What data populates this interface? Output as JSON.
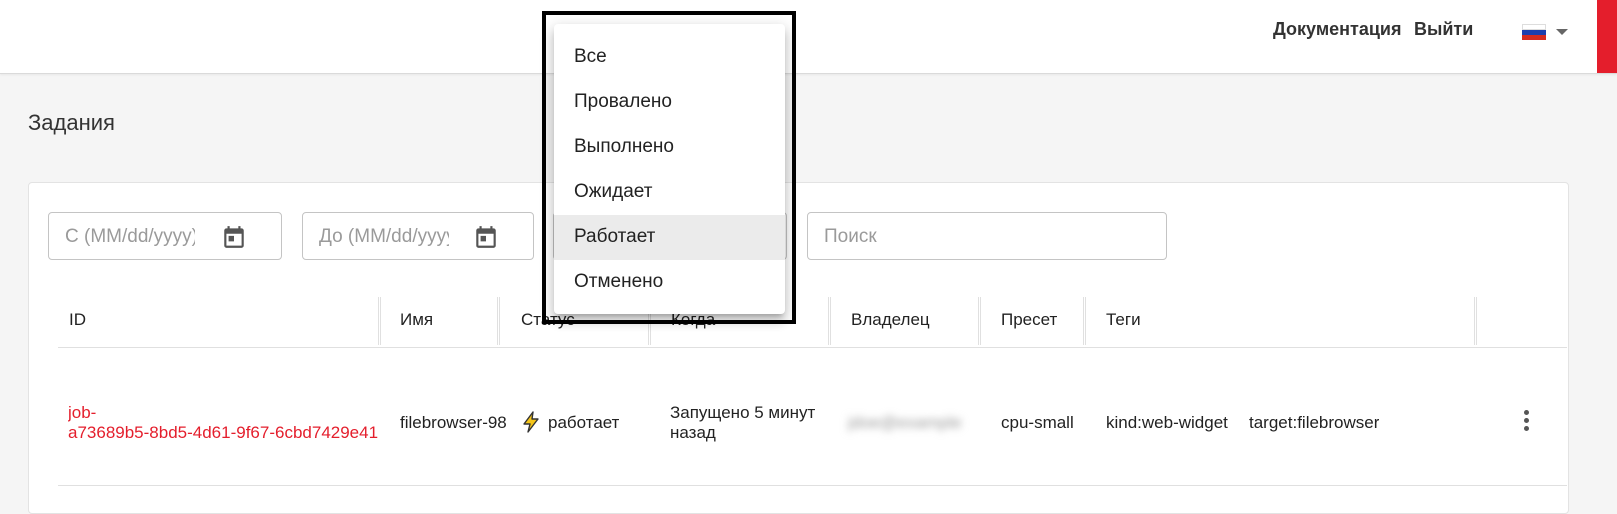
{
  "header": {
    "docs_label": "Документация",
    "logout_label": "Выйти",
    "language_flag": "ru-flag-icon",
    "accent_color": "#e41e2c"
  },
  "page": {
    "title": "Задания"
  },
  "filters": {
    "from_placeholder": "С (MM/dd/yyyy)",
    "to_placeholder": "До (MM/dd/yyyy)",
    "search_placeholder": "Поиск"
  },
  "table": {
    "headers": [
      "ID",
      "Имя",
      "Статус",
      "Когда",
      "Владелец",
      "Пресет",
      "Теги"
    ],
    "rows": [
      {
        "id_line1": "job-",
        "id_line2": "a73689b5-8bd5-4d61-9f67-6cbd7429e41",
        "name": "filebrowser-98",
        "status": "работает",
        "status_icon": "lightning-icon",
        "when_line1": "Запущено 5 минут",
        "when_line2": "назад",
        "owner": "jdoe@example",
        "preset": "cpu-small",
        "tags": [
          "kind:web-widget",
          "target:filebrowser"
        ]
      }
    ]
  },
  "status_menu": {
    "items": [
      "Все",
      "Провалено",
      "Выполнено",
      "Ожидает",
      "Работает",
      "Отменено"
    ],
    "selected": "Работает"
  }
}
